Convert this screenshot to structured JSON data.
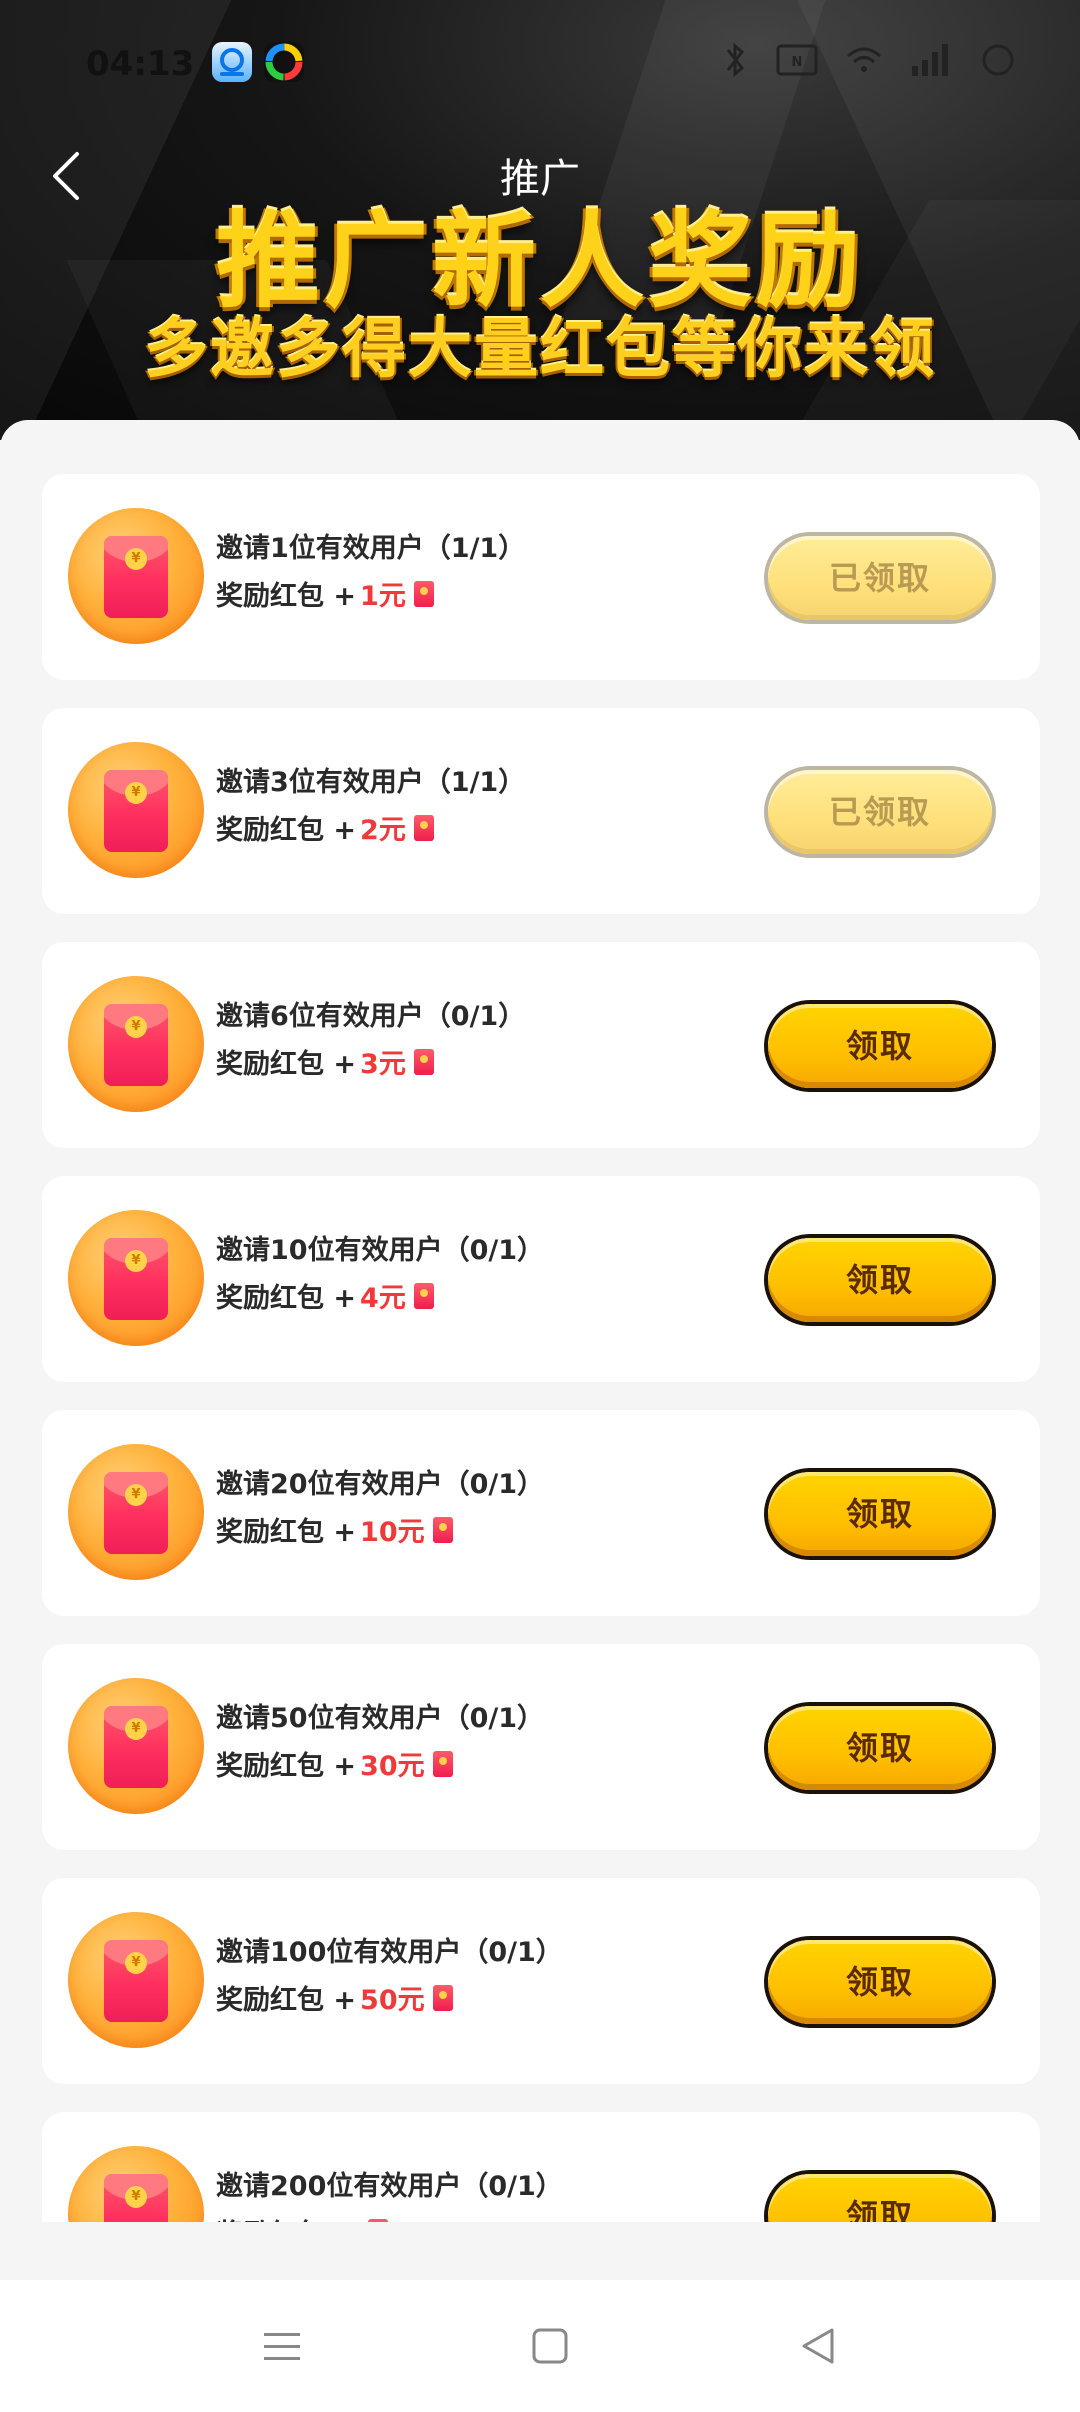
{
  "status_bar": {
    "time": "04:13",
    "app_icons": [
      "qq-browser-icon",
      "colorful-app-icon"
    ],
    "right_icons": [
      "bluetooth-icon",
      "nfc-icon",
      "wifi-icon",
      "signal-icon",
      "battery-icon"
    ]
  },
  "header": {
    "back_icon": "chevron-left-icon",
    "title": "推广",
    "banner_title": "推广新人奖励",
    "banner_subtitle": "多邀多得大量红包等你来领"
  },
  "rewards": [
    {
      "title": "邀请1位有效用户（1/1）",
      "prefix": "奖励红包 +",
      "amount": "1元",
      "button": "已领取",
      "claimed": true
    },
    {
      "title": "邀请3位有效用户（1/1）",
      "prefix": "奖励红包 +",
      "amount": "2元",
      "button": "已领取",
      "claimed": true
    },
    {
      "title": "邀请6位有效用户（0/1）",
      "prefix": "奖励红包 +",
      "amount": "3元",
      "button": "领取",
      "claimed": false
    },
    {
      "title": "邀请10位有效用户（0/1）",
      "prefix": "奖励红包 +",
      "amount": "4元",
      "button": "领取",
      "claimed": false
    },
    {
      "title": "邀请20位有效用户（0/1）",
      "prefix": "奖励红包 +",
      "amount": "10元",
      "button": "领取",
      "claimed": false
    },
    {
      "title": "邀请50位有效用户（0/1）",
      "prefix": "奖励红包 +",
      "amount": "30元",
      "button": "领取",
      "claimed": false
    },
    {
      "title": "邀请100位有效用户（0/1）",
      "prefix": "奖励红包 +",
      "amount": "50元",
      "button": "领取",
      "claimed": false
    },
    {
      "title": "邀请200位有效用户（0/1）",
      "prefix": "奖励红包 +",
      "amount": "",
      "button": "领取",
      "claimed": false
    }
  ],
  "colors": {
    "banner_gold": "#ffd21a",
    "amount_red": "#ef3a3a",
    "button_active": "#ffc400",
    "button_claimed": "#ffe48a"
  },
  "nav_bar": {
    "icons": [
      "menu-icon",
      "home-square-icon",
      "back-triangle-icon"
    ]
  }
}
